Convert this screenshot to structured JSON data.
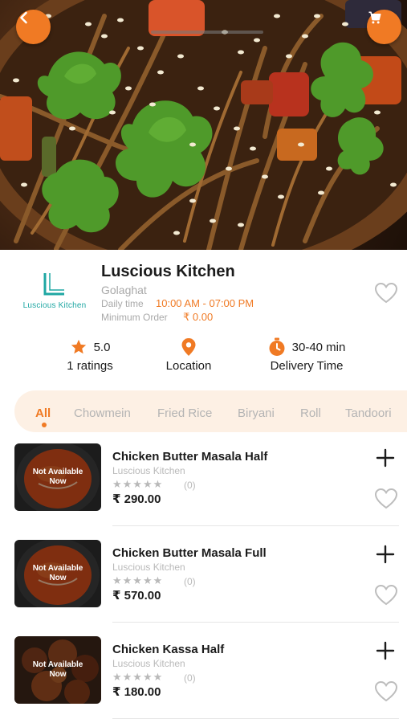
{
  "colors": {
    "accent": "#f07a24",
    "tab_bg": "#fdf0e4",
    "muted": "#a9a9a9",
    "logo_teal": "#1fa7a3"
  },
  "header": {
    "back_icon": "chevron-left-icon",
    "cart_icon": "shopping-cart-icon"
  },
  "restaurant": {
    "logo_letter": "L",
    "logo_text": "Luscious Kitchen",
    "name": "Luscious Kitchen",
    "location": "Golaghat",
    "time_label": "Daily time",
    "time": "10:00 AM - 07:00 PM",
    "min_label": "Minimum Order",
    "min_order": "₹ 0.00"
  },
  "stats": {
    "rating_value": "5.0",
    "rating_label": "1 ratings",
    "location_label": "Location",
    "delivery_value": "30-40 min",
    "delivery_label": "Delivery Time"
  },
  "tabs": [
    "All",
    "Chowmein",
    "Fried Rice",
    "Biryani",
    "Roll",
    "Tandoori"
  ],
  "items": [
    {
      "name": "Chicken Butter Masala Half",
      "restaurant": "Luscious Kitchen",
      "stars": "★★★★★",
      "rating_count": "(0)",
      "price": "₹ 290.00",
      "badge_line1": "Not Available",
      "badge_line2": "Now"
    },
    {
      "name": "Chicken Butter Masala Full",
      "restaurant": "Luscious Kitchen",
      "stars": "★★★★★",
      "rating_count": "(0)",
      "price": "₹ 570.00",
      "badge_line1": "Not Available",
      "badge_line2": "Now"
    },
    {
      "name": "Chicken Kassa Half",
      "restaurant": "Luscious Kitchen",
      "stars": "★★★★★",
      "rating_count": "(0)",
      "price": "₹ 180.00",
      "badge_line1": "Not Available",
      "badge_line2": "Now"
    }
  ]
}
